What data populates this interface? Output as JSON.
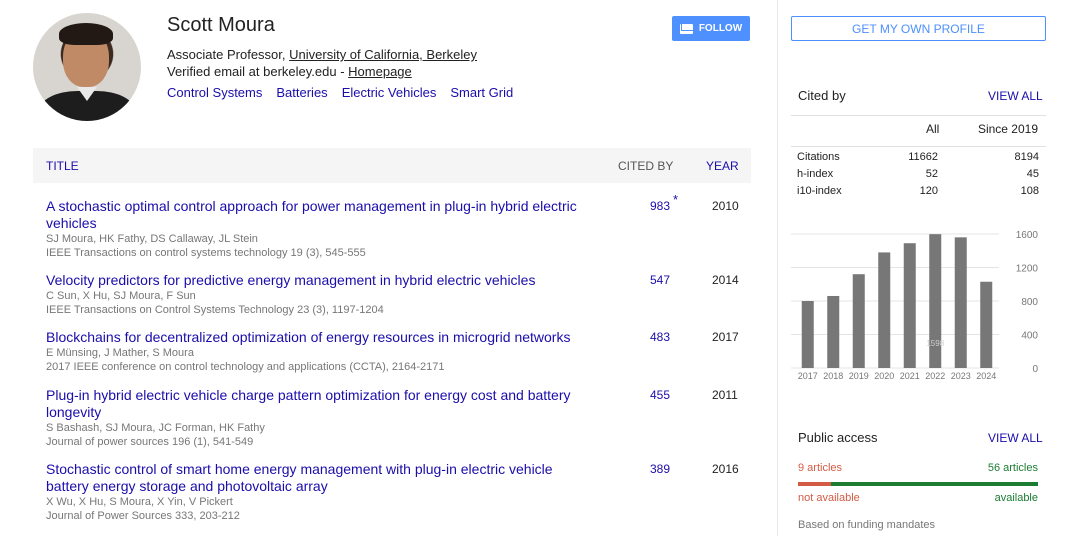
{
  "profile": {
    "name": "Scott Moura",
    "affiliation_prefix": "Associate Professor,",
    "affiliation_link": "University of California, Berkeley",
    "email_text": "Verified email at berkeley.edu -",
    "homepage_link": "Homepage",
    "interests": [
      "Control Systems",
      "Batteries",
      "Electric Vehicles",
      "Smart Grid"
    ],
    "follow_label": "FOLLOW"
  },
  "table": {
    "headers": {
      "title": "TITLE",
      "cited_by": "CITED BY",
      "year": "YEAR"
    },
    "rows": [
      {
        "title": "A stochastic optimal control approach for power management in plug-in hybrid electric vehicles",
        "authors": "SJ Moura, HK Fathy, DS Callaway, JL Stein",
        "venue": "IEEE Transactions on control systems technology 19 (3), 545-555",
        "cited": "983",
        "star": "*",
        "year": "2010"
      },
      {
        "title": "Velocity predictors for predictive energy management in hybrid electric vehicles",
        "authors": "C Sun, X Hu, SJ Moura, F Sun",
        "venue": "IEEE Transactions on Control Systems Technology 23 (3), 1197-1204",
        "cited": "547",
        "star": "",
        "year": "2014"
      },
      {
        "title": "Blockchains for decentralized optimization of energy resources in microgrid networks",
        "authors": "E Münsing, J Mather, S Moura",
        "venue": "2017 IEEE conference on control technology and applications (CCTA), 2164-2171",
        "cited": "483",
        "star": "",
        "year": "2017"
      },
      {
        "title": "Plug-in hybrid electric vehicle charge pattern optimization for energy cost and battery longevity",
        "authors": "S Bashash, SJ Moura, JC Forman, HK Fathy",
        "venue": "Journal of power sources 196 (1), 541-549",
        "cited": "455",
        "star": "",
        "year": "2011"
      },
      {
        "title": "Stochastic control of smart home energy management with plug-in electric vehicle battery energy storage and photovoltaic array",
        "authors": "X Wu, X Hu, S Moura, X Yin, V Pickert",
        "venue": "Journal of Power Sources 333, 203-212",
        "cited": "389",
        "star": "",
        "year": "2016"
      }
    ]
  },
  "sidebar": {
    "get_profile_label": "GET MY OWN PROFILE",
    "cited_by": {
      "heading": "Cited by",
      "view_all": "VIEW ALL",
      "col_all": "All",
      "col_since": "Since 2019",
      "rows": [
        {
          "label": "Citations",
          "all": "11662",
          "since": "8194"
        },
        {
          "label": "h-index",
          "all": "52",
          "since": "45"
        },
        {
          "label": "i10-index",
          "all": "120",
          "since": "108"
        }
      ]
    },
    "public_access": {
      "heading": "Public access",
      "view_all": "VIEW ALL",
      "not_available_count": "9 articles",
      "available_count": "56 articles",
      "not_available_label": "not available",
      "available_label": "available",
      "footnote": "Based on funding mandates",
      "colors": {
        "not_available": "#d35b44",
        "available": "#1c7c32"
      }
    }
  },
  "chart_data": {
    "type": "bar",
    "categories": [
      "2017",
      "2018",
      "2019",
      "2020",
      "2021",
      "2022",
      "2023",
      "2024"
    ],
    "values": [
      800,
      860,
      1120,
      1380,
      1490,
      1598,
      1560,
      1030
    ],
    "yticks": [
      "0",
      "400",
      "800",
      "1200",
      "1600"
    ],
    "ylim": [
      0,
      1600
    ],
    "bar_color": "#777777",
    "hover_label": "1598"
  }
}
